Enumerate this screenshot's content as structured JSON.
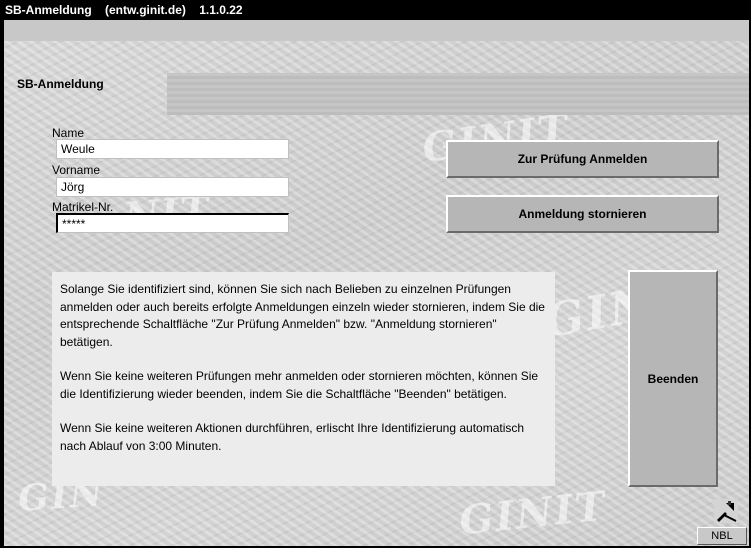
{
  "window": {
    "title": "SB-Anmeldung    (entw.ginit.de)    1.1.0.22"
  },
  "section": {
    "title": "SB-Anmeldung"
  },
  "form": {
    "name_label": "Name",
    "name_value": "Weule",
    "vorname_label": "Vorname",
    "vorname_value": "Jörg",
    "matrikel_label": "Matrikel-Nr.",
    "matrikel_value": "*****"
  },
  "buttons": {
    "register": "Zur Prüfung Anmelden",
    "cancel": "Anmeldung stornieren",
    "finish": "Beenden"
  },
  "info": {
    "p1": "Solange Sie identifiziert sind, können Sie sich nach Belieben zu einzelnen Prüfungen anmelden oder auch bereits erfolgte Anmeldungen einzeln wieder stornieren, indem Sie die entsprechende Schaltfläche \"Zur Prüfung Anmelden\" bzw. \"Anmeldung stornieren\" betätigen.",
    "p2": "Wenn Sie keine weiteren Prüfungen mehr anmelden oder stornieren möchten, können Sie die Identifizierung wieder beenden, indem Sie die Schaltfläche \"Beenden\" betätigen.",
    "p3": "Wenn Sie keine weiteren Aktionen durchführen, erlischt Ihre Identifizierung automatisch nach Ablauf von 3:00 Minuten."
  },
  "status": {
    "badge": "NBL"
  },
  "watermark": {
    "text": "GINIT"
  }
}
